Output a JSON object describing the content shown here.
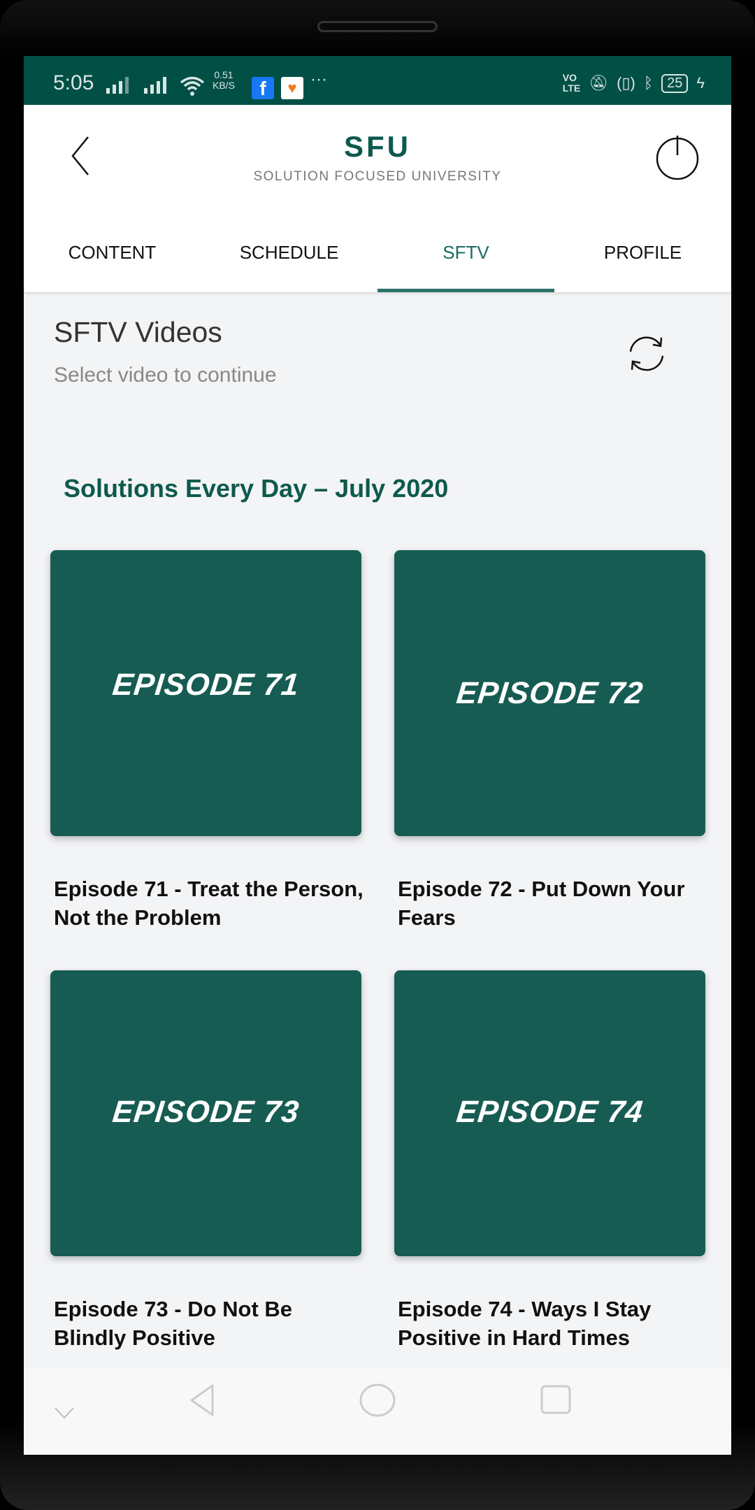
{
  "status_bar": {
    "time": "5:05",
    "net_speed": "0.51",
    "net_unit": "KB/S",
    "volte": "VO",
    "lte": "LTE",
    "battery": "25",
    "more": "···"
  },
  "header": {
    "title": "SFU",
    "subtitle": "SOLUTION FOCUSED UNIVERSITY"
  },
  "tabs": [
    {
      "label": "CONTENT"
    },
    {
      "label": "SCHEDULE"
    },
    {
      "label": "SFTV",
      "active": true
    },
    {
      "label": "PROFILE"
    }
  ],
  "page": {
    "title": "SFTV Videos",
    "subtitle": "Select video to continue",
    "section": "Solutions Every Day – July 2020"
  },
  "videos": [
    {
      "thumb": "EPISODE 71",
      "title": "Episode 71 - Treat the Person, Not the Problem"
    },
    {
      "thumb": "EPISODE 72",
      "title": "Episode 72 - Put Down Your Fears"
    },
    {
      "thumb": "EPISODE 73",
      "title": "Episode 73 - Do Not Be Blindly Positive"
    },
    {
      "thumb": "EPISODE 74",
      "title": "Episode 74 - Ways I Stay Positive in Hard Times"
    }
  ],
  "colors": {
    "status_bar": "#024f46",
    "accent": "#0e5a4d",
    "card": "#175c53",
    "background": "#f3f4f6"
  }
}
